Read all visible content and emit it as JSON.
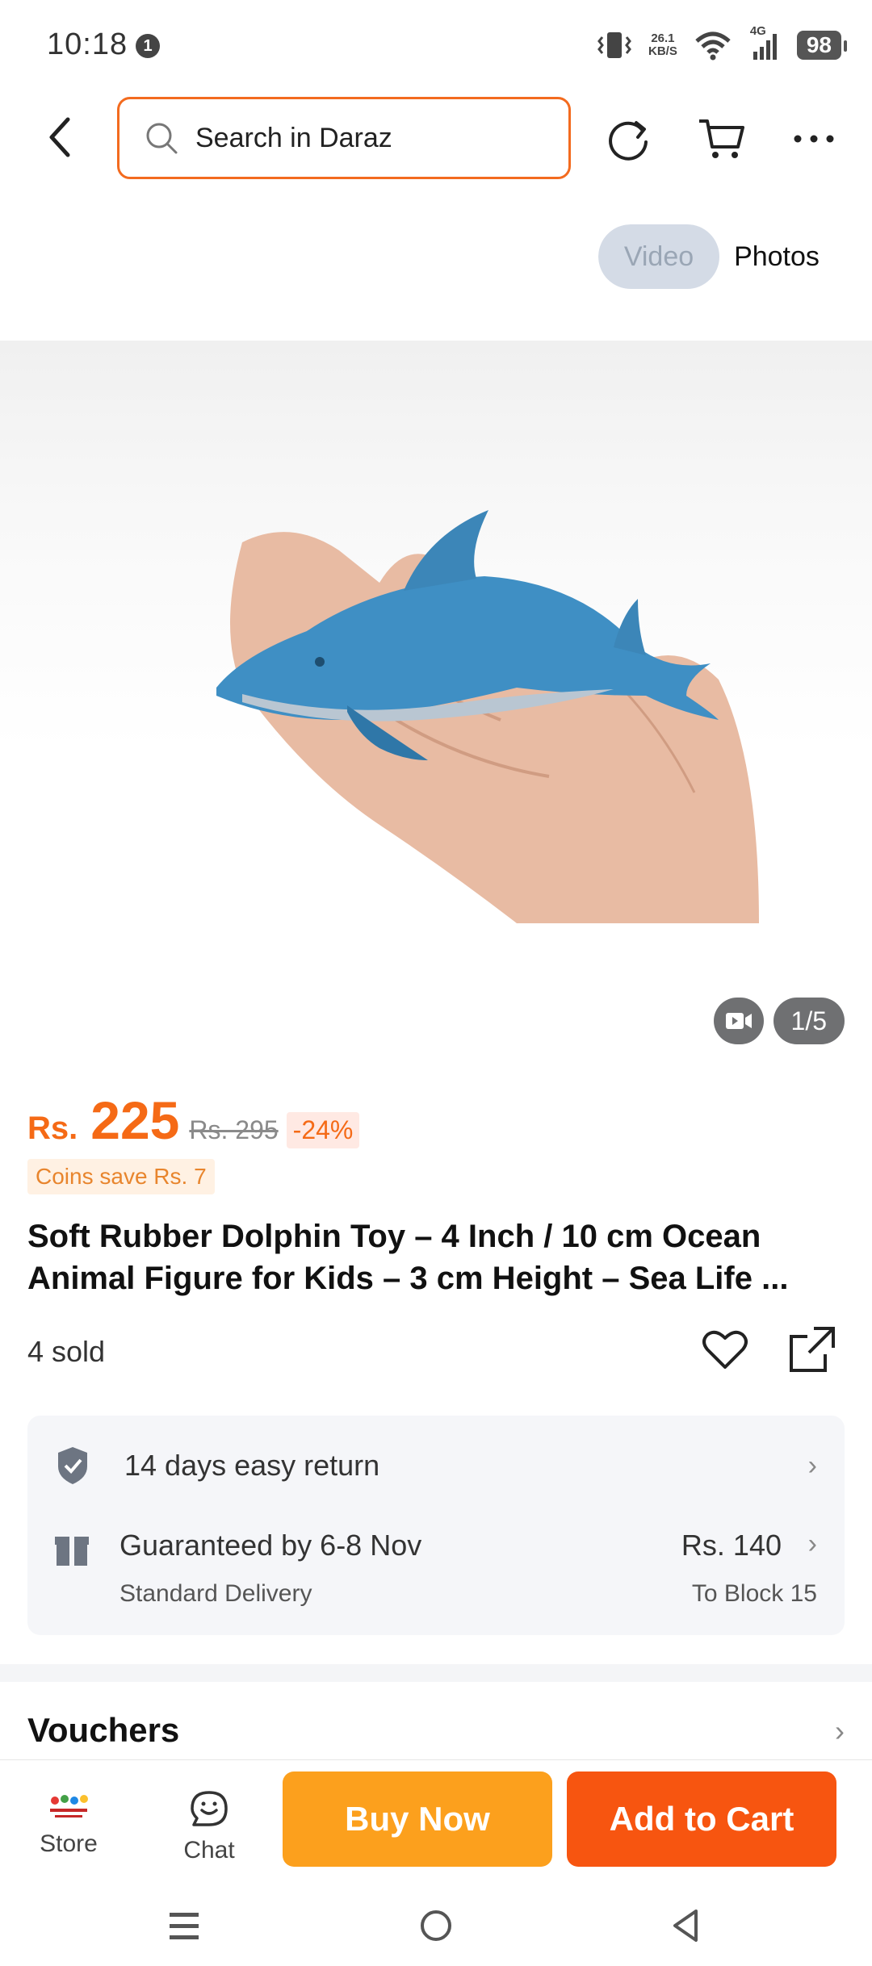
{
  "status_bar": {
    "time": "10:18",
    "notif_count": "1",
    "net_speed_value": "26.1",
    "net_speed_unit": "KB/S",
    "network": "4G",
    "battery": "98"
  },
  "search": {
    "placeholder": "Search in Daraz"
  },
  "media_toggle": {
    "video": "Video",
    "photos": "Photos"
  },
  "media_counter": "1/5",
  "price": {
    "currency": "Rs.",
    "amount": "225",
    "original": "Rs. 295",
    "discount": "-24%",
    "coins": "Coins save Rs. 7"
  },
  "product": {
    "title": "Soft Rubber Dolphin Toy – 4 Inch / 10 cm Ocean Animal Figure for Kids – 3 cm Height – Sea Life ...",
    "sold": "4 sold"
  },
  "delivery": {
    "return": "14 days easy return",
    "guarantee": "Guaranteed by 6-8 Nov",
    "type": "Standard Delivery",
    "fee": "Rs. 140",
    "destination": "To Block 15"
  },
  "vouchers": "Vouchers",
  "bottom_bar": {
    "store": "Store",
    "chat": "Chat",
    "buy_now": "Buy Now",
    "add_to_cart": "Add to Cart"
  },
  "colors": {
    "accent": "#f56a16",
    "buy": "#fca01d",
    "cart": "#f75510"
  }
}
